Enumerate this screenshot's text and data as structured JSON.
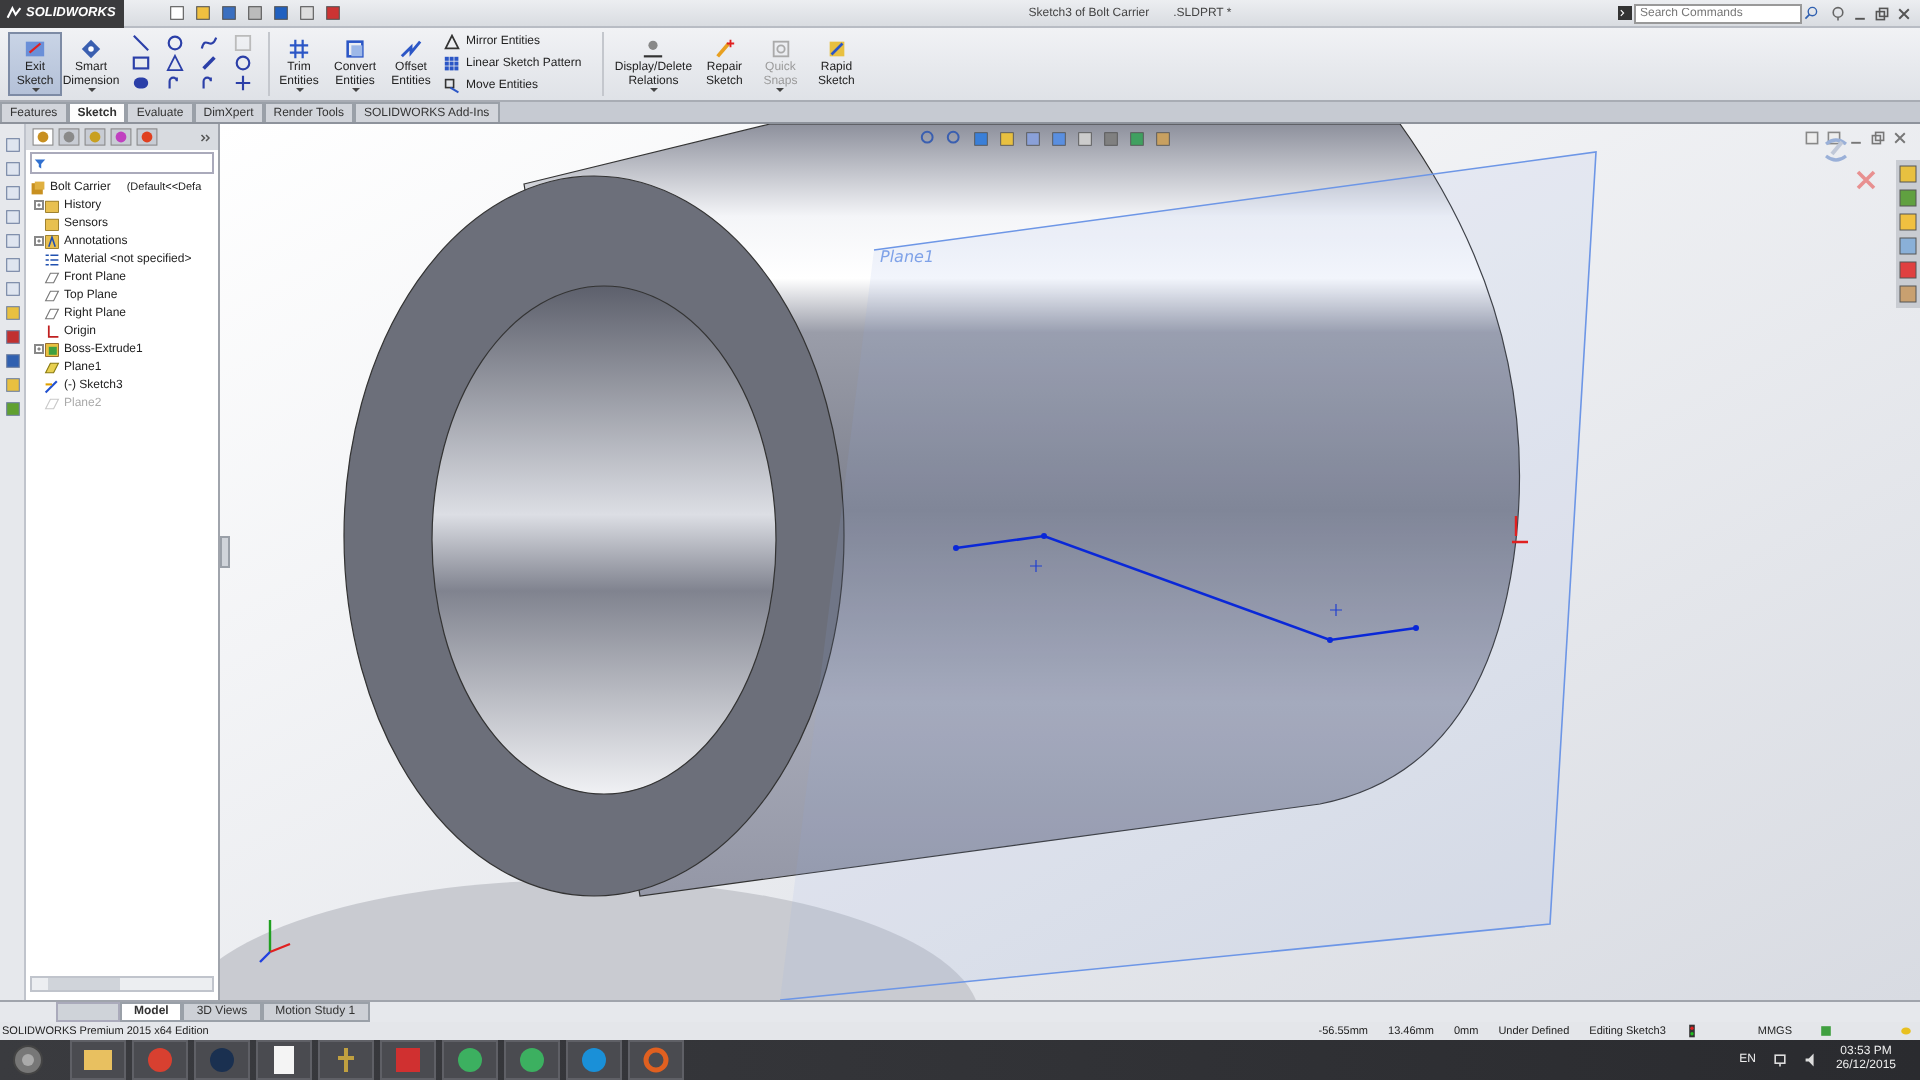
{
  "title_bar": {
    "logo": "SOLIDWORKS",
    "title": "Sketch3 of Bolt Carrier",
    "file": ".SLDPRT *",
    "search": {
      "placeholder": "Search Commands"
    }
  },
  "ribbon": [
    {
      "kind": "large",
      "label": "Exit Sketch",
      "selected": true,
      "disabled": false,
      "dropdown": true
    },
    {
      "kind": "large",
      "label": "Smart Dimension",
      "selected": false,
      "disabled": false,
      "dropdown": true
    },
    {
      "kind": "grid"
    },
    {
      "kind": "large",
      "label": "Trim Entities",
      "selected": false,
      "disabled": false,
      "dropdown": true
    },
    {
      "kind": "large",
      "label": "Convert Entities",
      "selected": false,
      "disabled": false,
      "dropdown": true
    },
    {
      "kind": "large",
      "label": "Offset Entities",
      "selected": false,
      "disabled": false,
      "dropdown": false
    },
    {
      "kind": "stack",
      "items": [
        {
          "label": "Mirror Entities"
        },
        {
          "label": "Linear Sketch Pattern"
        },
        {
          "label": "Move Entities"
        }
      ]
    },
    {
      "kind": "large",
      "label": "Display/Delete Relations",
      "selected": false,
      "disabled": false,
      "dropdown": true
    },
    {
      "kind": "large",
      "label": "Repair Sketch",
      "selected": false,
      "disabled": false,
      "dropdown": false
    },
    {
      "kind": "large",
      "label": "Quick Snaps",
      "selected": false,
      "disabled": true,
      "dropdown": true
    },
    {
      "kind": "large",
      "label": "Rapid Sketch",
      "selected": false,
      "disabled": false,
      "dropdown": false
    }
  ],
  "command_tabs": [
    {
      "label": "Features",
      "selected": false
    },
    {
      "label": "Sketch",
      "selected": true
    },
    {
      "label": "Evaluate",
      "selected": false
    },
    {
      "label": "DimXpert",
      "selected": false
    },
    {
      "label": "Render Tools",
      "selected": false
    },
    {
      "label": "SOLIDWORKS Add-Ins",
      "selected": false
    }
  ],
  "feature_tree": {
    "label": "Bolt Carrier",
    "config": "(Default<<Defa",
    "children": [
      {
        "label": "History",
        "kind": "folder",
        "collapsed": true,
        "disabled": false
      },
      {
        "label": "Sensors",
        "kind": "folder",
        "collapsed": false,
        "disabled": false
      },
      {
        "label": "Annotations",
        "kind": "annotation",
        "collapsed": true,
        "disabled": false
      },
      {
        "label": "Material <not specified>",
        "kind": "material",
        "collapsed": false,
        "disabled": false
      },
      {
        "label": "Front Plane",
        "kind": "plane",
        "collapsed": false,
        "disabled": false
      },
      {
        "label": "Top Plane",
        "kind": "plane",
        "collapsed": false,
        "disabled": false
      },
      {
        "label": "Right Plane",
        "kind": "plane",
        "collapsed": false,
        "disabled": false
      },
      {
        "label": "Origin",
        "kind": "origin",
        "collapsed": false,
        "disabled": false
      },
      {
        "label": "Boss-Extrude1",
        "kind": "feature",
        "collapsed": true,
        "disabled": false
      },
      {
        "label": "Plane1",
        "kind": "reference-plane",
        "collapsed": false,
        "disabled": false
      },
      {
        "label": "(-) Sketch3",
        "kind": "sketch",
        "collapsed": false,
        "disabled": false
      },
      {
        "label": "Plane2",
        "kind": "plane",
        "collapsed": false,
        "disabled": true
      }
    ]
  },
  "viewport": {
    "plane_label": "Plane1"
  },
  "bottom_tabs": [
    {
      "label": "Model",
      "selected": true
    },
    {
      "label": "3D Views",
      "selected": false
    },
    {
      "label": "Motion Study 1",
      "selected": false
    }
  ],
  "status_bar": {
    "edition": "SOLIDWORKS Premium 2015 x64 Edition",
    "x": "-56.55mm",
    "y": "13.46mm",
    "z": "0mm",
    "state": "Under Defined",
    "mode": "Editing Sketch3",
    "units": "MMGS"
  },
  "taskbar": {
    "language": "EN",
    "time": "03:53 PM",
    "date": "26/12/2015"
  }
}
